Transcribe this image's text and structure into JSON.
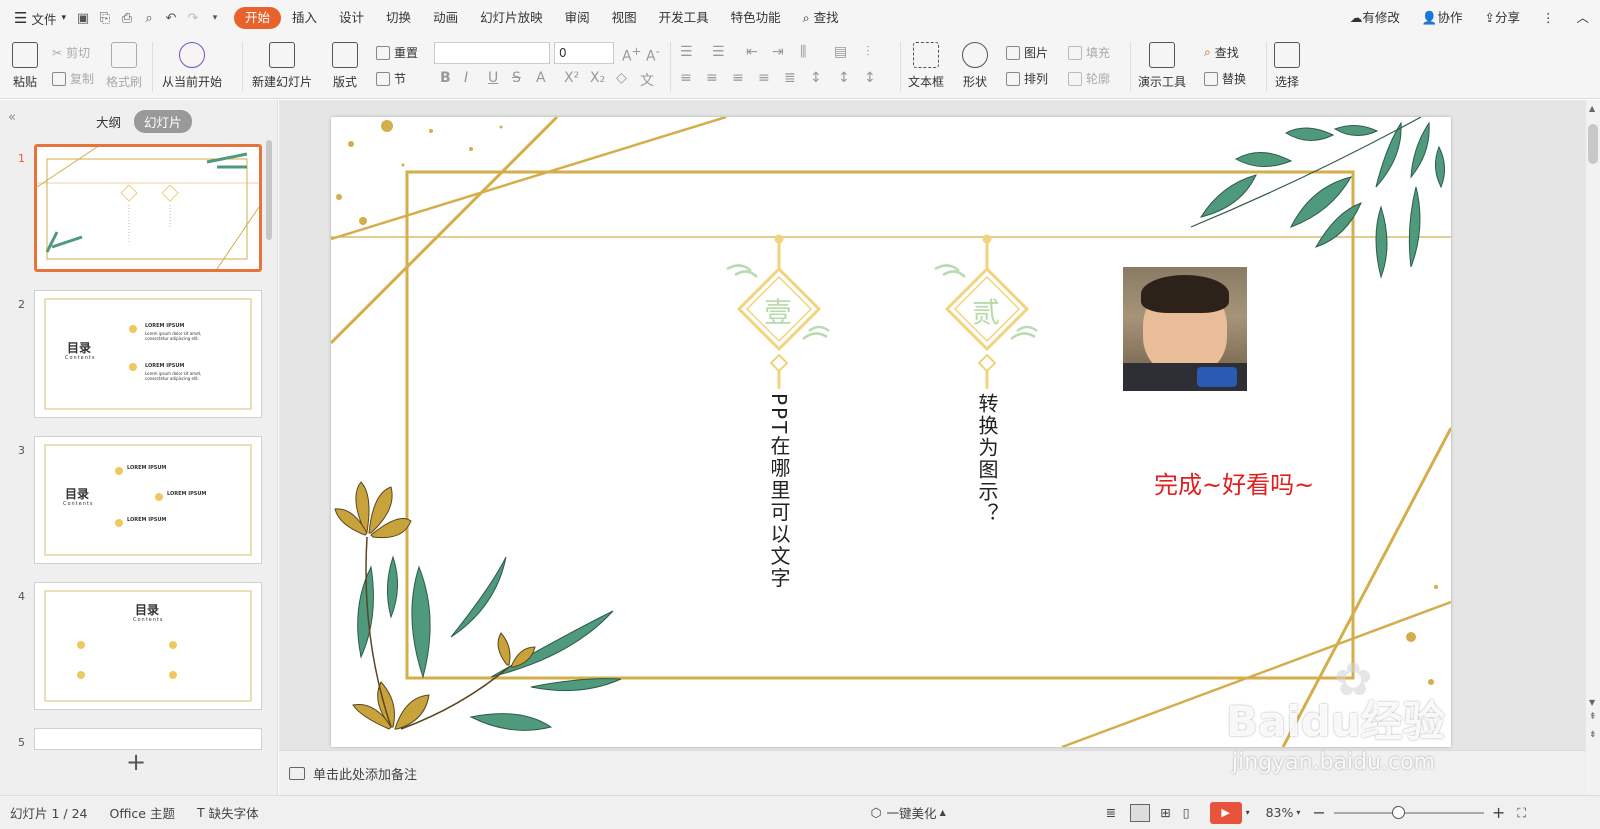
{
  "menubar": {
    "file_label": "文件",
    "tabs": [
      "开始",
      "插入",
      "设计",
      "切换",
      "动画",
      "幻灯片放映",
      "审阅",
      "视图",
      "开发工具",
      "特色功能"
    ],
    "search_label": "查找",
    "right": {
      "has_changes": "有修改",
      "collaborate": "协作",
      "share": "分享"
    }
  },
  "ribbon": {
    "paste": "粘贴",
    "cut": "剪切",
    "copy": "复制",
    "format_painter": "格式刷",
    "from_current": "从当前开始",
    "new_slide": "新建幻灯片",
    "layout": "版式",
    "reset": "重置",
    "section": "节",
    "font_size_value": "0",
    "text_box": "文本框",
    "shape": "形状",
    "picture": "图片",
    "fill": "填充",
    "arrange": "排列",
    "outline": "轮廓",
    "presenter_tools": "演示工具",
    "find": "查找",
    "replace": "替换",
    "select": "选择"
  },
  "leftpanel": {
    "tab_outline": "大纲",
    "tab_slides": "幻灯片",
    "thumb_numbers": [
      "1",
      "2",
      "3",
      "4",
      "5"
    ],
    "toc_title": "目录",
    "toc_sub": "Contents",
    "lorem_head": "LOREM IPSUM",
    "lorem_body": "Lorem ipsum dolor sit amet, consectetur adipiscing elit."
  },
  "slide": {
    "badge1": "壹",
    "badge2": "贰",
    "vtext1": "PPT在哪里可以文字",
    "vtext2": "转换为图示？",
    "caption": "完成~好看吗~",
    "caption_color": "#e02020",
    "gold": "#d4ae4b",
    "leaf": "#4f9a7c"
  },
  "notes": {
    "placeholder": "单击此处添加备注"
  },
  "status": {
    "slide_count": "幻灯片 1 / 24",
    "theme": "Office 主题",
    "missing_font": "缺失字体",
    "beautify": "一键美化",
    "zoom": "83%"
  },
  "watermark": {
    "brand": "Baidu经验",
    "url": "jingyan.baidu.com"
  }
}
